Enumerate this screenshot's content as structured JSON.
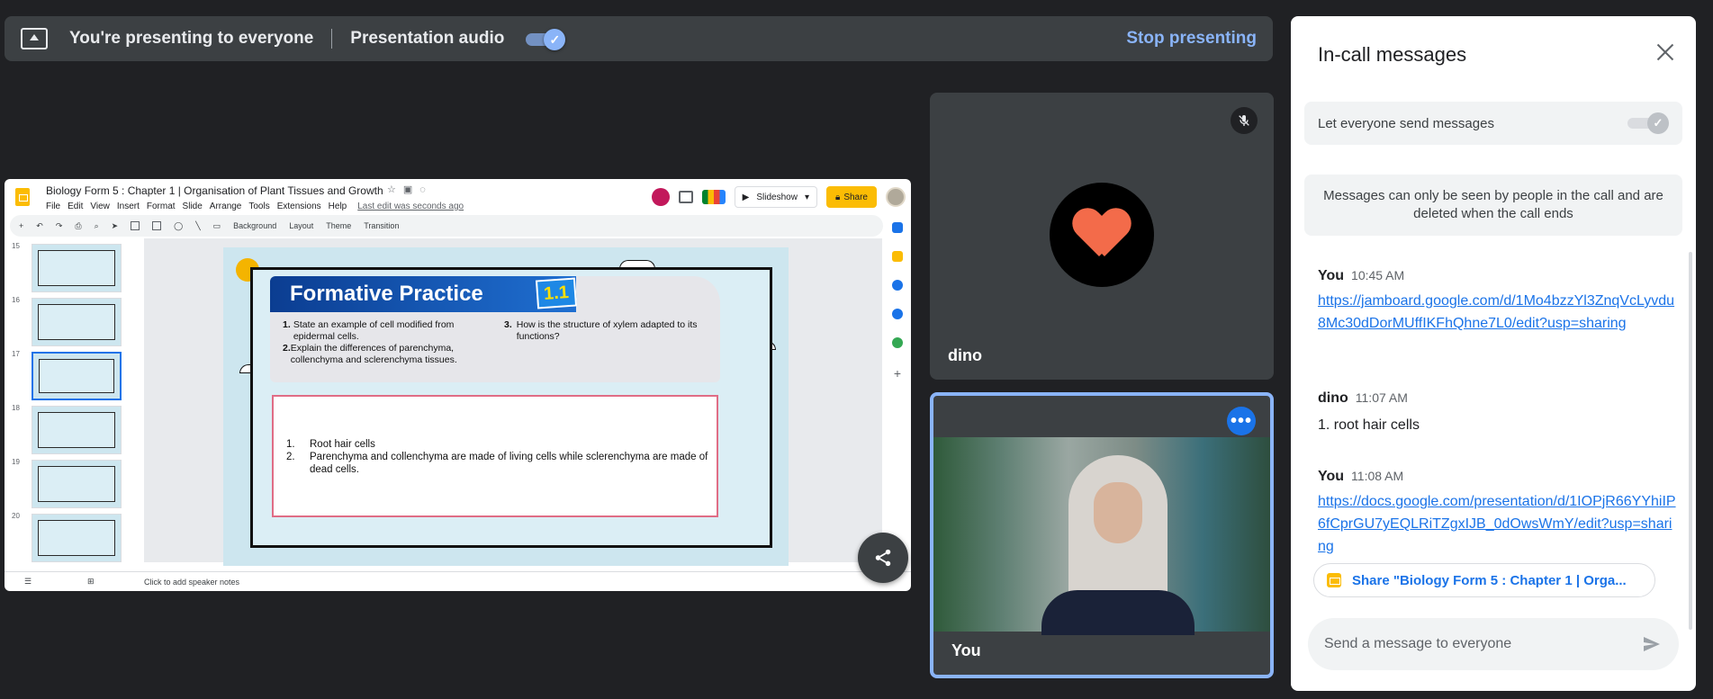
{
  "presenting_bar": {
    "status_text": "You're presenting to everyone",
    "audio_label": "Presentation audio",
    "audio_enabled": true,
    "stop_label": "Stop presenting"
  },
  "slides": {
    "doc_title": "Biology Form 5 : Chapter 1 | Organisation of Plant Tissues and Growth",
    "menu": [
      "File",
      "Edit",
      "View",
      "Insert",
      "Format",
      "Slide",
      "Arrange",
      "Tools",
      "Extensions",
      "Help"
    ],
    "last_edit": "Last edit was seconds ago",
    "slideshow_label": "Slideshow",
    "share_label": "Share",
    "toolbar": [
      "Background",
      "Layout",
      "Theme",
      "Transition"
    ],
    "slide_numbers": [
      "15",
      "16",
      "17",
      "18",
      "19",
      "20"
    ],
    "selected_slide": "17",
    "notes_placeholder": "Click to add speaker notes",
    "slide_content": {
      "heading": "Formative Practice",
      "badge": "1.1",
      "q1_num": "1.",
      "q1": "State an example of cell modified from epidermal cells.",
      "q2_num": "2.",
      "q2": "Explain the differences of parenchyma, collenchyma and sclerenchyma tissues.",
      "q3_num": "3.",
      "q3": "How is the structure of xylem adapted to its functions?",
      "a1_num": "1.",
      "a1": "Root hair cells",
      "a2_num": "2.",
      "a2": "Parenchyma and collenchyma are made of living cells while sclerenchyma are made of dead cells."
    }
  },
  "tiles": {
    "dino_name": "dino",
    "you_name": "You",
    "more_label": "•••"
  },
  "chat": {
    "title": "In-call messages",
    "let_everyone_label": "Let everyone send messages",
    "info_text": "Messages can only be seen by people in the call and are deleted when the call ends",
    "messages": [
      {
        "sender": "You",
        "time": "10:45 AM",
        "link": "https://jamboard.google.com/d/1Mo4bzzYl3ZnqVcLyvdu8Mc30dDorMUffIKFhQhne7L0/edit?usp=sharing"
      },
      {
        "sender": "dino",
        "time": "11:07 AM",
        "text": "1. root hair cells"
      },
      {
        "sender": "You",
        "time": "11:08 AM",
        "link": "https://docs.google.com/presentation/d/1IOPjR66YYhiIP6fCprGU7yEQLRiTZgxIJB_0dOwsWmY/edit?usp=sharing"
      }
    ],
    "share_chip": "Share \"Biology Form 5 : Chapter 1 | Orga...",
    "send_placeholder": "Send a message to everyone"
  },
  "colors": {
    "accent_blue": "#8ab4f8",
    "link_blue": "#1a73e8",
    "slides_yellow": "#fbbc04",
    "background": "#202124"
  }
}
